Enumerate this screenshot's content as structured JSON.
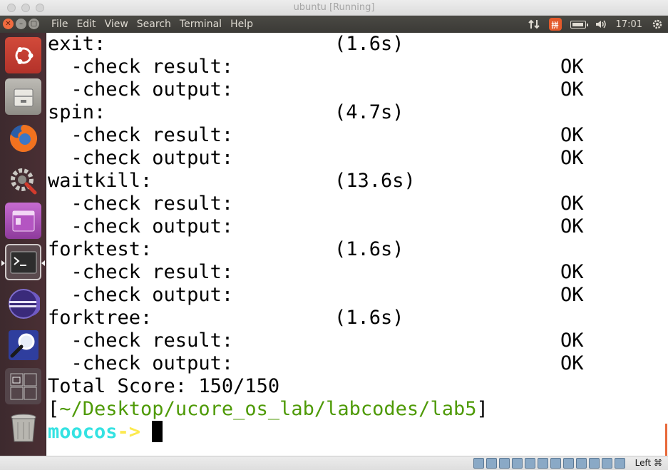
{
  "host_window": {
    "title": "ubuntu [Running]"
  },
  "panel": {
    "menu": [
      "File",
      "Edit",
      "View",
      "Search",
      "Terminal",
      "Help"
    ],
    "ime_label": "拼",
    "clock": "17:01",
    "icons": [
      "network-arrows-icon",
      "input-method-icon",
      "battery-icon",
      "volume-icon",
      "settings-gear-icon"
    ]
  },
  "launcher": {
    "items": [
      "ubuntu-dash-icon",
      "files-icon",
      "firefox-icon",
      "system-settings-icon",
      "app-purple-icon",
      "terminal-icon",
      "eclipse-icon",
      "search-magnifier-icon",
      "workspace-switcher-icon",
      "trash-icon"
    ]
  },
  "terminal": {
    "lines": [
      {
        "label": "exit:",
        "time": "(1.6s)",
        "status": ""
      },
      {
        "label": "  -check result:",
        "time": "",
        "status": "OK"
      },
      {
        "label": "  -check output:",
        "time": "",
        "status": "OK"
      },
      {
        "label": "spin:",
        "time": "(4.7s)",
        "status": ""
      },
      {
        "label": "  -check result:",
        "time": "",
        "status": "OK"
      },
      {
        "label": "  -check output:",
        "time": "",
        "status": "OK"
      },
      {
        "label": "waitkill:",
        "time": "(13.6s)",
        "status": ""
      },
      {
        "label": "  -check result:",
        "time": "",
        "status": "OK"
      },
      {
        "label": "  -check output:",
        "time": "",
        "status": "OK"
      },
      {
        "label": "forktest:",
        "time": "(1.6s)",
        "status": ""
      },
      {
        "label": "  -check result:",
        "time": "",
        "status": "OK"
      },
      {
        "label": "  -check output:",
        "time": "",
        "status": "OK"
      },
      {
        "label": "forktree:",
        "time": "(1.6s)",
        "status": ""
      },
      {
        "label": "  -check result:",
        "time": "",
        "status": "OK"
      },
      {
        "label": "  -check output:",
        "time": "",
        "status": "OK"
      }
    ],
    "total_score": "Total Score: 150/150",
    "path_open": "[",
    "path": "~/Desktop/ucore_os_lab/labcodes/lab5",
    "path_close": "]",
    "prompt_user": "moocos",
    "prompt_arrow": "->",
    "colors": {
      "path": "#4e9a06",
      "prompt_user": "#34e2e2",
      "prompt_arrow": "#fce94f"
    }
  },
  "statusbar": {
    "host_key": "Left ⌘",
    "icons": [
      "hdd-icon",
      "cd-icon",
      "usb-icon",
      "network-icon",
      "pen-icon",
      "display-icon",
      "screen-icon",
      "shared-folder-icon",
      "capture-icon",
      "cpu-icon",
      "mouse-integration-icon",
      "arrow-down-icon"
    ]
  }
}
